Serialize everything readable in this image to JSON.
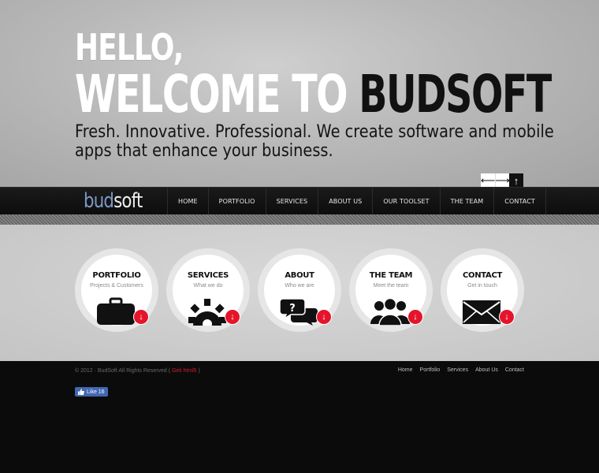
{
  "hero": {
    "line1": "HELLO,",
    "line2_white": "WELCOME TO ",
    "line2_black": "BUDSOFT",
    "tagline": "Fresh. Innovative. Professional. We create software and mobile apps that enhance your business.",
    "controls": {
      "prev": "⟵",
      "next": "⟶",
      "up": "↑"
    }
  },
  "nav": {
    "logo_bud": "bud",
    "logo_soft": "soft",
    "items": [
      "HOME",
      "PORTFOLIO",
      "SERVICES",
      "ABOUT US",
      "OUR TOOLSET",
      "THE TEAM",
      "CONTACT"
    ]
  },
  "features": [
    {
      "title": "PORTFOLIO",
      "subtitle": "Projects & Customers",
      "icon": "briefcase-icon"
    },
    {
      "title": "SERVICES",
      "subtitle": "What we do",
      "icon": "gear-icon"
    },
    {
      "title": "ABOUT",
      "subtitle": "Who we are",
      "icon": "chat-bubbles-icon"
    },
    {
      "title": "THE TEAM",
      "subtitle": "Meet the team",
      "icon": "people-icon"
    },
    {
      "title": "CONTACT",
      "subtitle": "Get in touch",
      "icon": "envelope-icon"
    }
  ],
  "feature_arrow": "↓",
  "footer": {
    "copyright_pre": "© 2012 · BudSoft All Rights Reserved ( ",
    "copyright_link": "Geli html5",
    "copyright_post": " )",
    "links": [
      "Home",
      "Portfolio",
      "Services",
      "About Us",
      "Contact"
    ],
    "fb_like": "Like 16"
  },
  "colors": {
    "accent_red": "#e4152b",
    "logo_blue": "#7d98c4",
    "fb_blue": "#4267b2"
  }
}
